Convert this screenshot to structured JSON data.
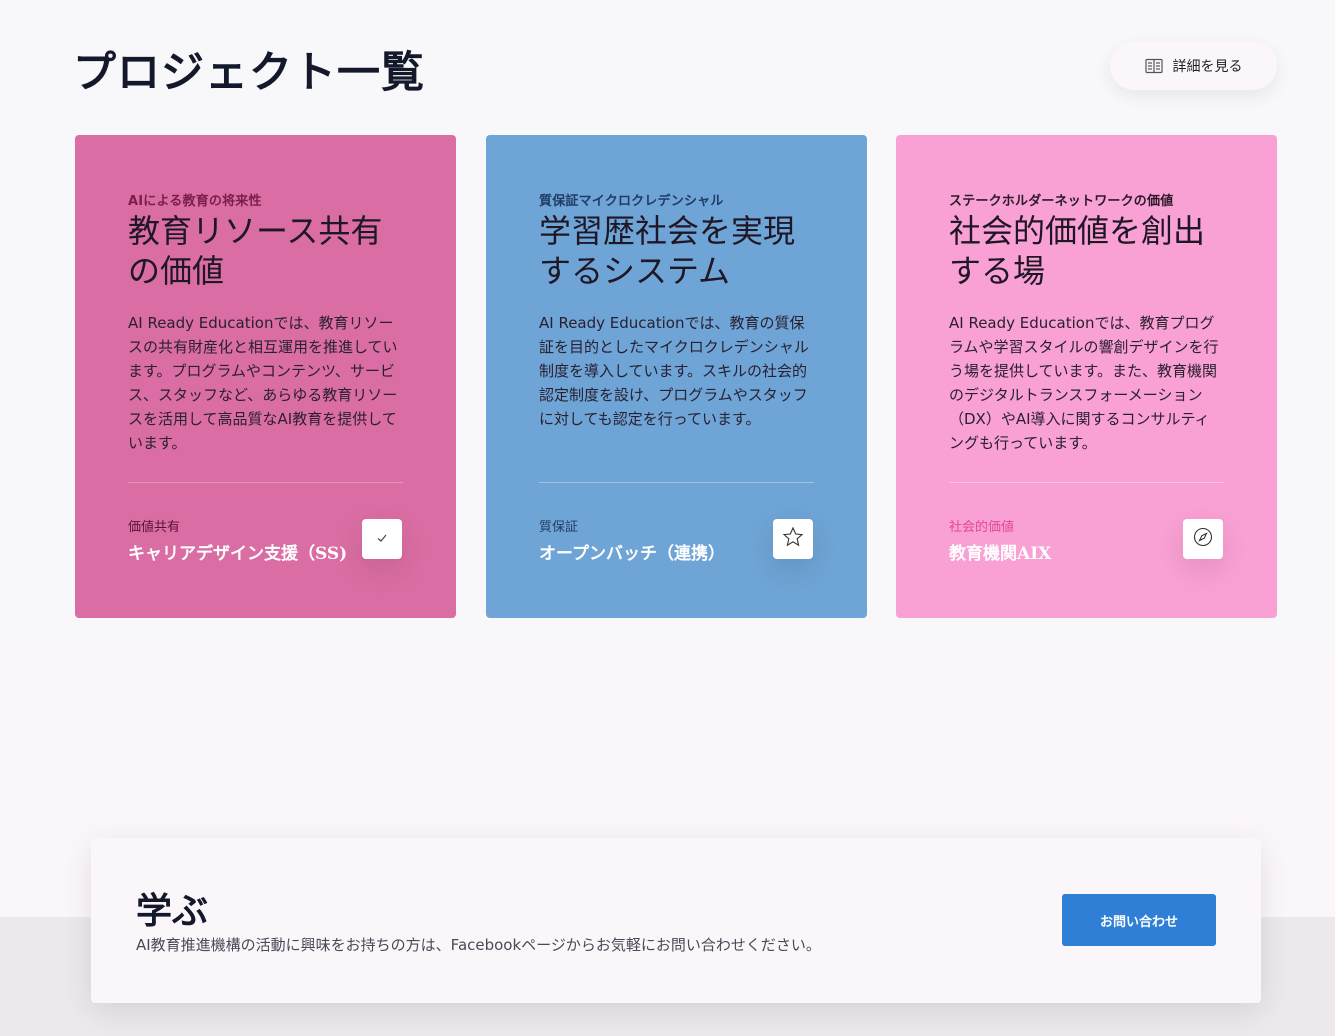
{
  "header": {
    "title": "プロジェクト一覧",
    "details_label": "詳細を見る"
  },
  "cards": [
    {
      "eyebrow": "AIによる教育の将来性",
      "heading": "教育リソース共有の価値",
      "body": "AI Ready Educationでは、教育リソースの共有財産化と相互運用を推進しています。プログラムやコンテンツ、サービス、スタッフなど、あらゆる教育リソースを活用して高品質なAI教育を提供しています。",
      "category": "価値共有",
      "name": "キャリアデザイン支援（SS)",
      "icon": "check-icon",
      "color": "#da6da3"
    },
    {
      "eyebrow": "質保証マイクロクレデンシャル",
      "heading": "学習歴社会を実現するシステム",
      "body": "AI Ready Educationでは、教育の質保証を目的としたマイクロクレデンシャル制度を導入しています。スキルの社会的認定制度を設け、プログラムやスタッフに対しても認定を行っています。",
      "category": "質保証",
      "name": "オープンバッチ（連携）",
      "icon": "star-icon",
      "color": "#6ea4d6"
    },
    {
      "eyebrow": "ステークホルダーネットワークの価値",
      "heading": "社会的価値を創出する場",
      "body": "AI Ready Educationでは、教育プログラムや学習スタイルの響創デザインを行う場を提供しています。また、教育機関のデジタルトランスフォーメーション（DX）やAI導入に関するコンサルティングも行っています。",
      "category": "社会的価値",
      "name": "教育機関AIX",
      "icon": "compass-icon",
      "color": "#f9a0d4"
    }
  ],
  "learn": {
    "title": "学ぶ",
    "description": "AI教育推進機構の活動に興味をお持ちの方は、Facebookページからお気軽にお問い合わせください。",
    "contact_label": "お問い合わせ"
  }
}
